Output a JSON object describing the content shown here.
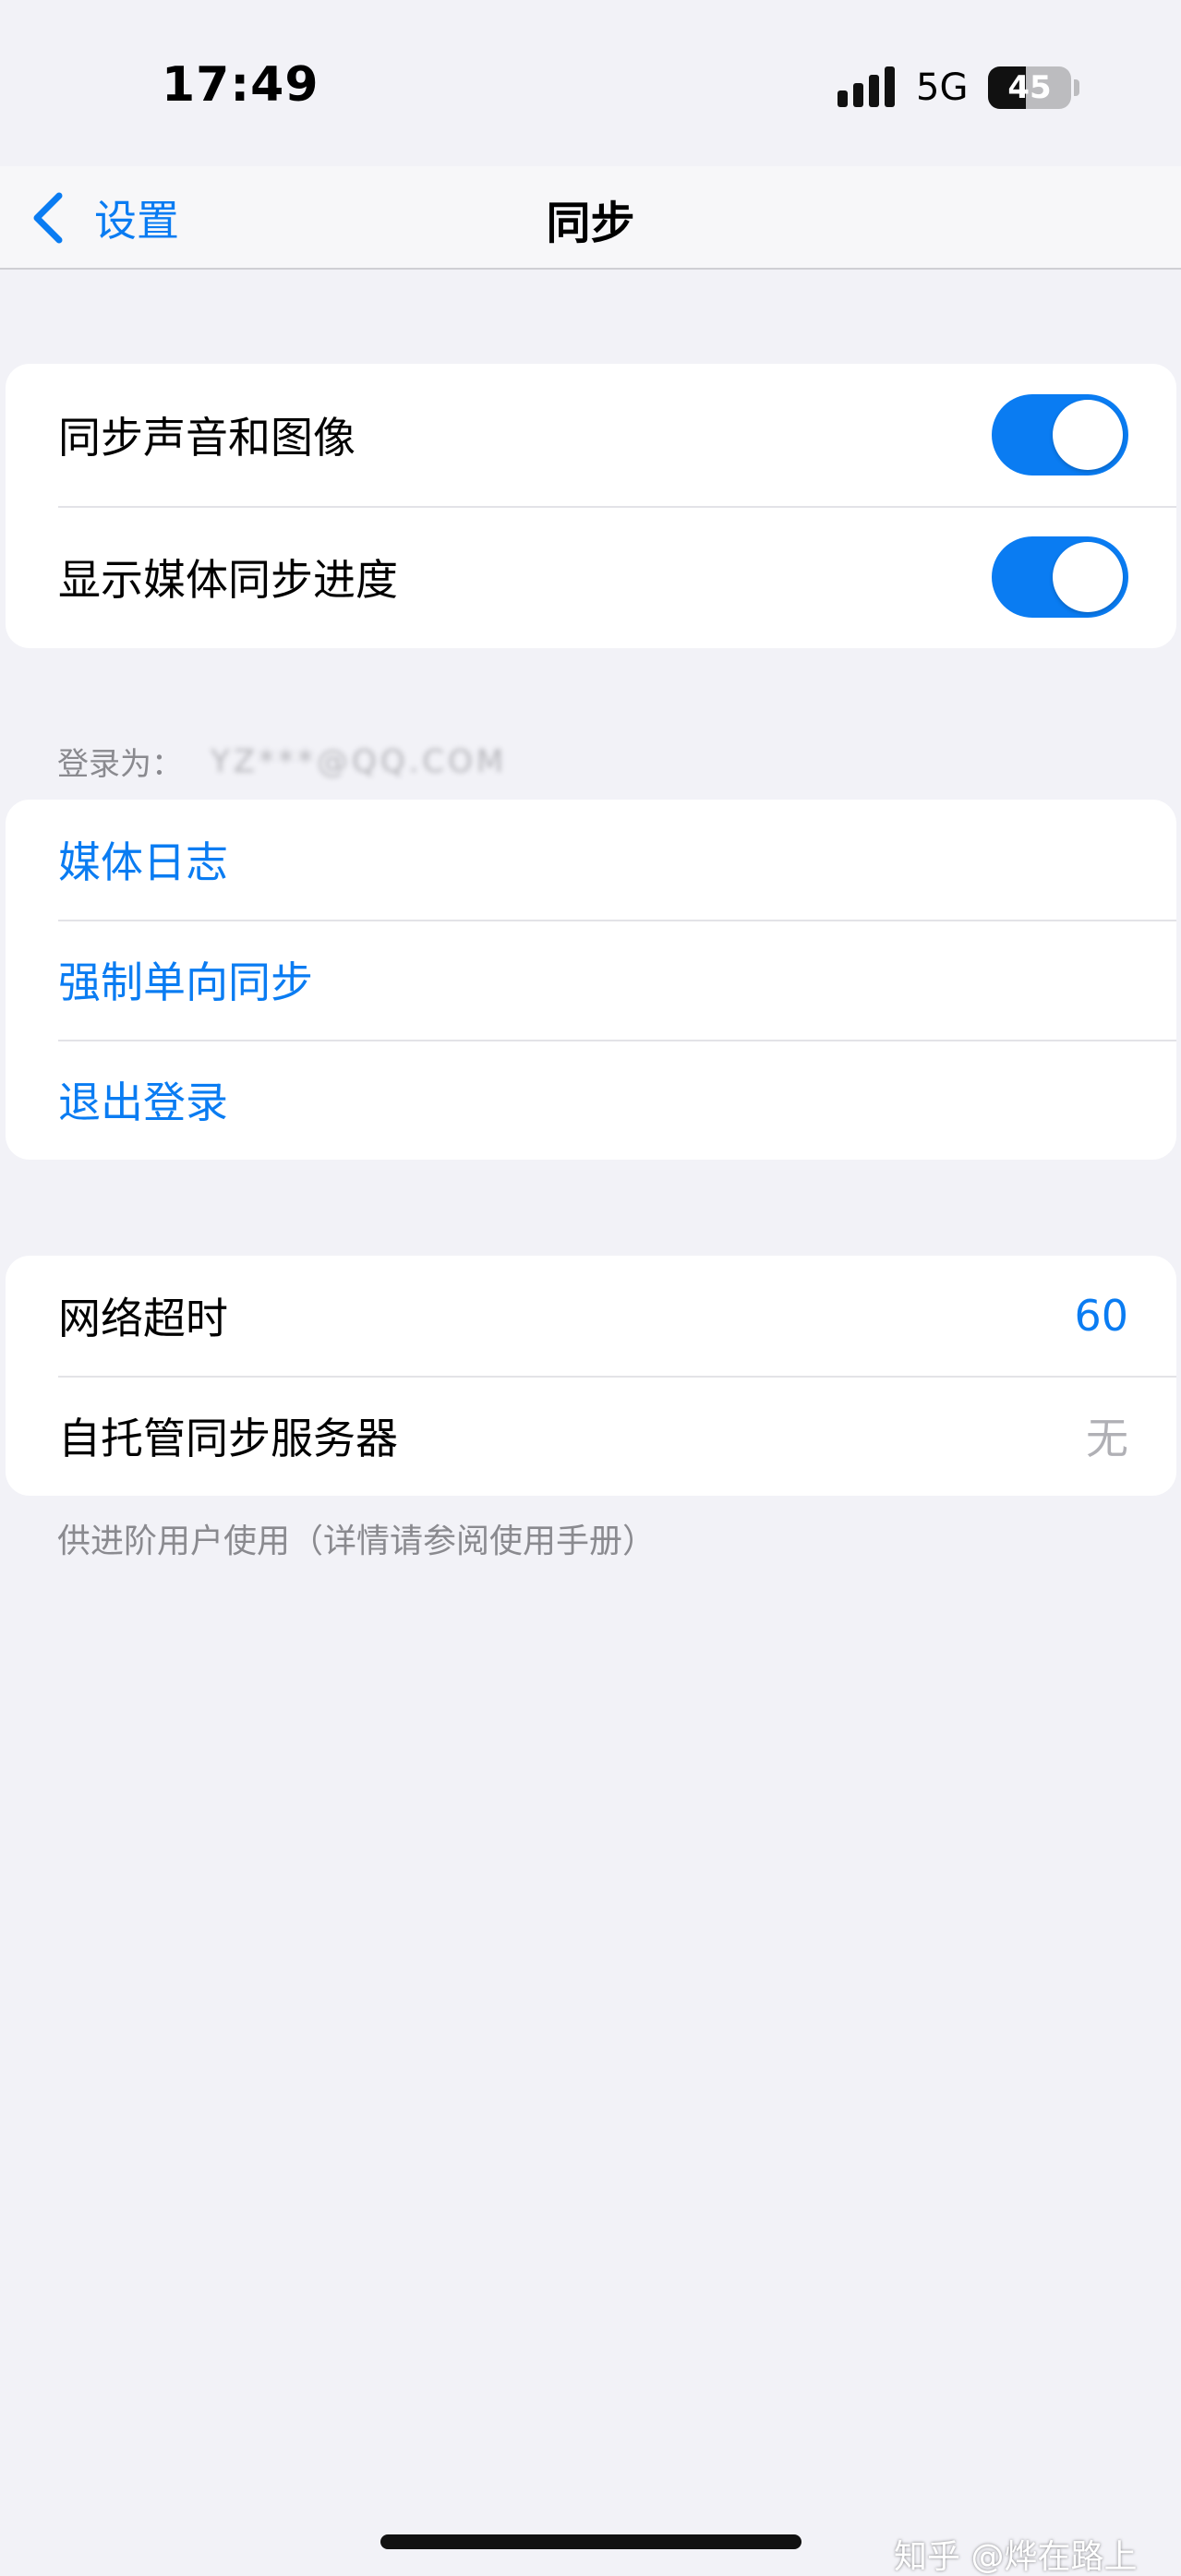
{
  "status_bar": {
    "time": "17:49",
    "network": "5G",
    "battery_level": "45",
    "battery_fraction": 0.45
  },
  "nav": {
    "back_label": "设置",
    "title": "同步"
  },
  "sync_group": {
    "items": [
      {
        "label": "同步声音和图像",
        "toggle_on": true
      },
      {
        "label": "显示媒体同步进度",
        "toggle_on": true
      }
    ]
  },
  "account": {
    "header_label": "登录为：",
    "account_id": "YZ***@QQ.COM"
  },
  "actions_group": {
    "items": [
      {
        "label": "媒体日志"
      },
      {
        "label": "强制单向同步"
      },
      {
        "label": "退出登录"
      }
    ]
  },
  "network_group": {
    "items": [
      {
        "label": "网络超时",
        "value": "60"
      },
      {
        "label": "自托管同步服务器",
        "value": "无"
      }
    ],
    "footer": "供进阶用户使用（详情请参阅使用手册）"
  },
  "watermark": "知乎 @烨在路上",
  "colors": {
    "accent": "#0a7cf2",
    "background": "#f2f2f7",
    "secondary_text": "#8a8a8f"
  },
  "icons": {
    "back": "chevron-left-icon",
    "signal": "cellular-signal-icon",
    "battery": "battery-icon"
  }
}
